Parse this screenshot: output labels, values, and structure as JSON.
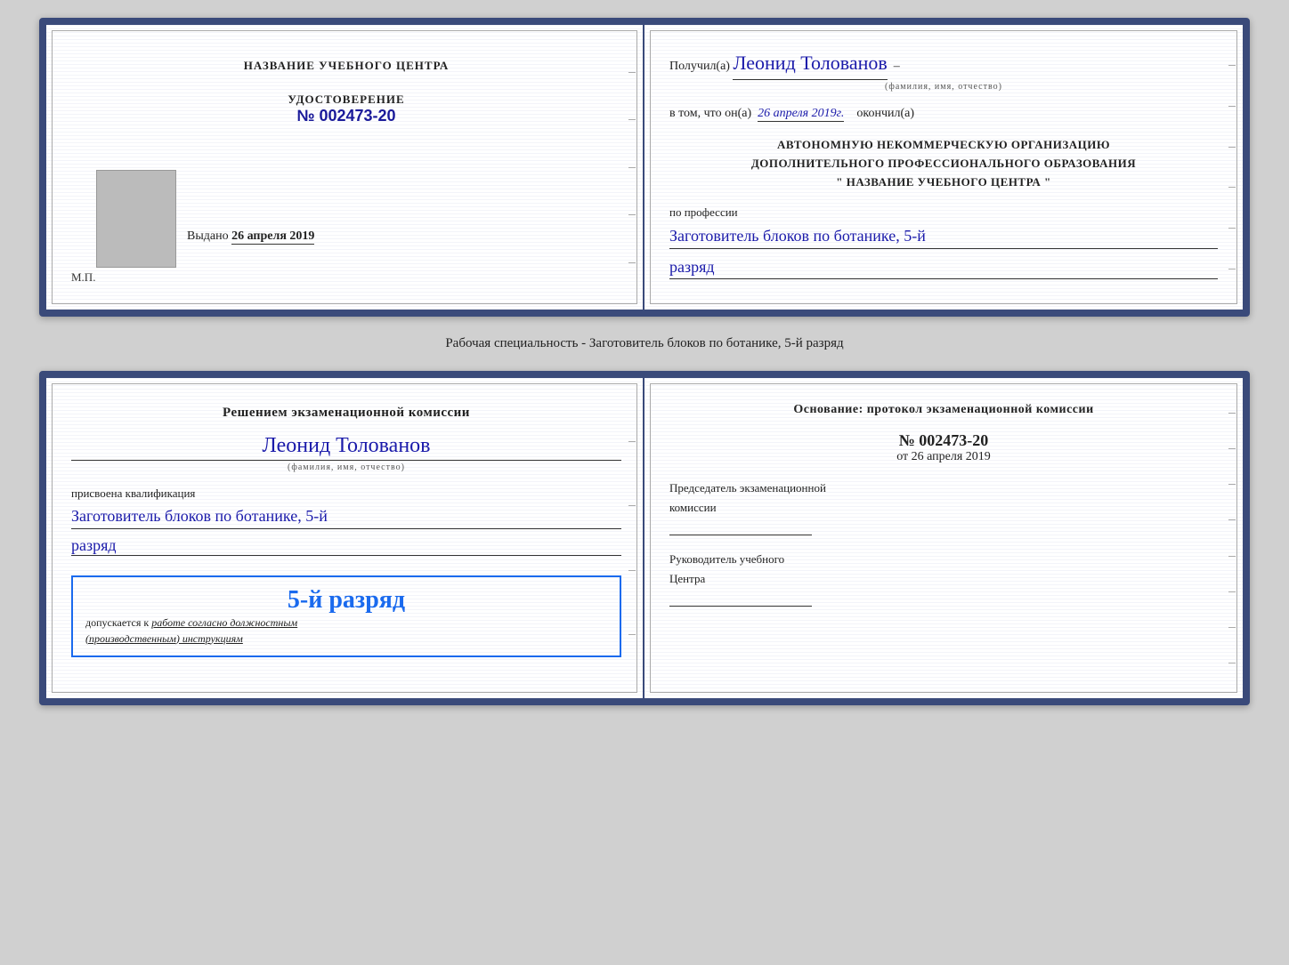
{
  "top_doc": {
    "left": {
      "center_title": "НАЗВАНИЕ УЧЕБНОГО ЦЕНТРА",
      "cert_label": "УДОСТОВЕРЕНИЕ",
      "cert_number": "№ 002473-20",
      "issued_prefix": "Выдано",
      "issued_date": "26 апреля 2019",
      "mp": "М.П."
    },
    "right": {
      "recipient_prefix": "Получил(а)",
      "recipient_name": "Леонид Толованов",
      "fio_subtitle": "(фамилия, имя, отчество)",
      "completion_prefix": "в том, что он(а)",
      "completion_date": "26 апреля 2019г.",
      "completion_suffix": "окончил(а)",
      "org_line1": "АВТОНОМНУЮ НЕКОММЕРЧЕСКУЮ ОРГАНИЗАЦИЮ",
      "org_line2": "ДОПОЛНИТЕЛЬНОГО ПРОФЕССИОНАЛЬНОГО ОБРАЗОВАНИЯ",
      "org_line3": "\"   НАЗВАНИЕ УЧЕБНОГО ЦЕНТРА   \"",
      "profession_prefix": "по профессии",
      "profession_name": "Заготовитель блоков по ботанике, 5-й",
      "razryad": "разряд"
    }
  },
  "specialty_label": "Рабочая специальность - Заготовитель блоков по ботанике, 5-й разряд",
  "bottom_doc": {
    "left": {
      "commission_line": "Решением экзаменационной комиссии",
      "recipient_name": "Леонид Толованов",
      "fio_subtitle": "(фамилия, имя, отчество)",
      "qualification_prefix": "присвоена квалификация",
      "qualification_name": "Заготовитель блоков по ботанике, 5-й",
      "razryad": "разряд",
      "stamp_rank": "5-й разряд",
      "stamp_admission_prefix": "допускается к",
      "stamp_admission_text": "работе согласно должностным",
      "stamp_admission_text2": "(производственным) инструкциям"
    },
    "right": {
      "basis_title": "Основание: протокол экзаменационной комиссии",
      "protocol_number": "№  002473-20",
      "protocol_date_prefix": "от",
      "protocol_date": "26 апреля 2019",
      "chairman_label": "Председатель экзаменационной",
      "chairman_label2": "комиссии",
      "director_label": "Руководитель учебного",
      "director_label2": "Центра"
    }
  }
}
